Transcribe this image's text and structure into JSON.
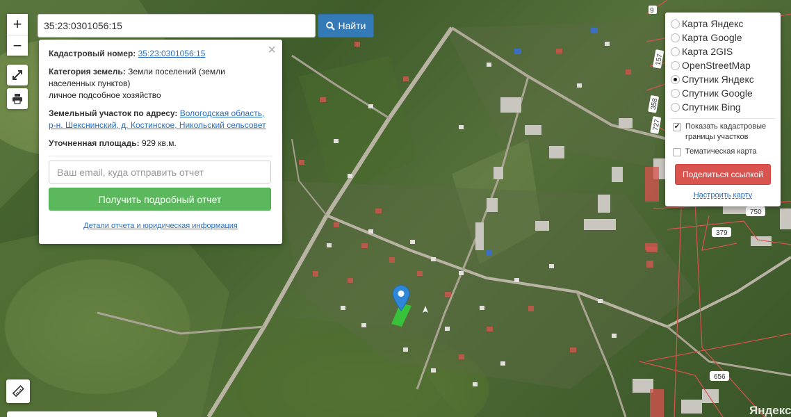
{
  "search": {
    "value": "35:23:0301056:15",
    "button_label": "Найти"
  },
  "zoom": {
    "in_label": "+",
    "out_label": "−"
  },
  "info": {
    "cadastral_label": "Кадастровый номер:",
    "cadastral_value": "35:23:0301056:15",
    "category_label": "Категория земель:",
    "category_value": "Земли поселений (земли населенных пунктов)",
    "use_value": "личное подсобное хозяйство",
    "address_label": "Земельный участок по адресу:",
    "address_value": "Вологодская область, р-н. Шекснинский, д. Костинское, Никольский сельсовет",
    "area_label": "Уточненная площадь:",
    "area_value": "929 кв.м.",
    "close_label": "×",
    "email_placeholder": "Ваш email, куда отправить отчет",
    "report_button": "Получить подробный отчет",
    "details_link": "Детали отчета и юридическая информация"
  },
  "layers": {
    "options": [
      {
        "label": "Карта Яндекс",
        "selected": false
      },
      {
        "label": "Карта Google",
        "selected": false
      },
      {
        "label": "Карта 2GIS",
        "selected": false
      },
      {
        "label": "OpenStreetMap",
        "selected": false
      },
      {
        "label": "Спутник Яндекс",
        "selected": true
      },
      {
        "label": "Спутник Google",
        "selected": false
      },
      {
        "label": "Спутник Bing",
        "selected": false
      }
    ],
    "show_borders_label": "Показать кадастровые границы участков",
    "show_borders_checked": true,
    "thematic_label": "Тематическая карта",
    "thematic_checked": false,
    "share_button": "Поделиться ссылкой",
    "setup_link": "Настроить карту"
  },
  "map": {
    "parcel_labels": [
      "9",
      "157",
      "358",
      "727",
      "750",
      "379",
      "656"
    ],
    "watermark": "Яндекс",
    "parcel_color": "#38c23a",
    "marker_color": "#2f86d6",
    "cadastral_border_color": "#d9534f"
  }
}
